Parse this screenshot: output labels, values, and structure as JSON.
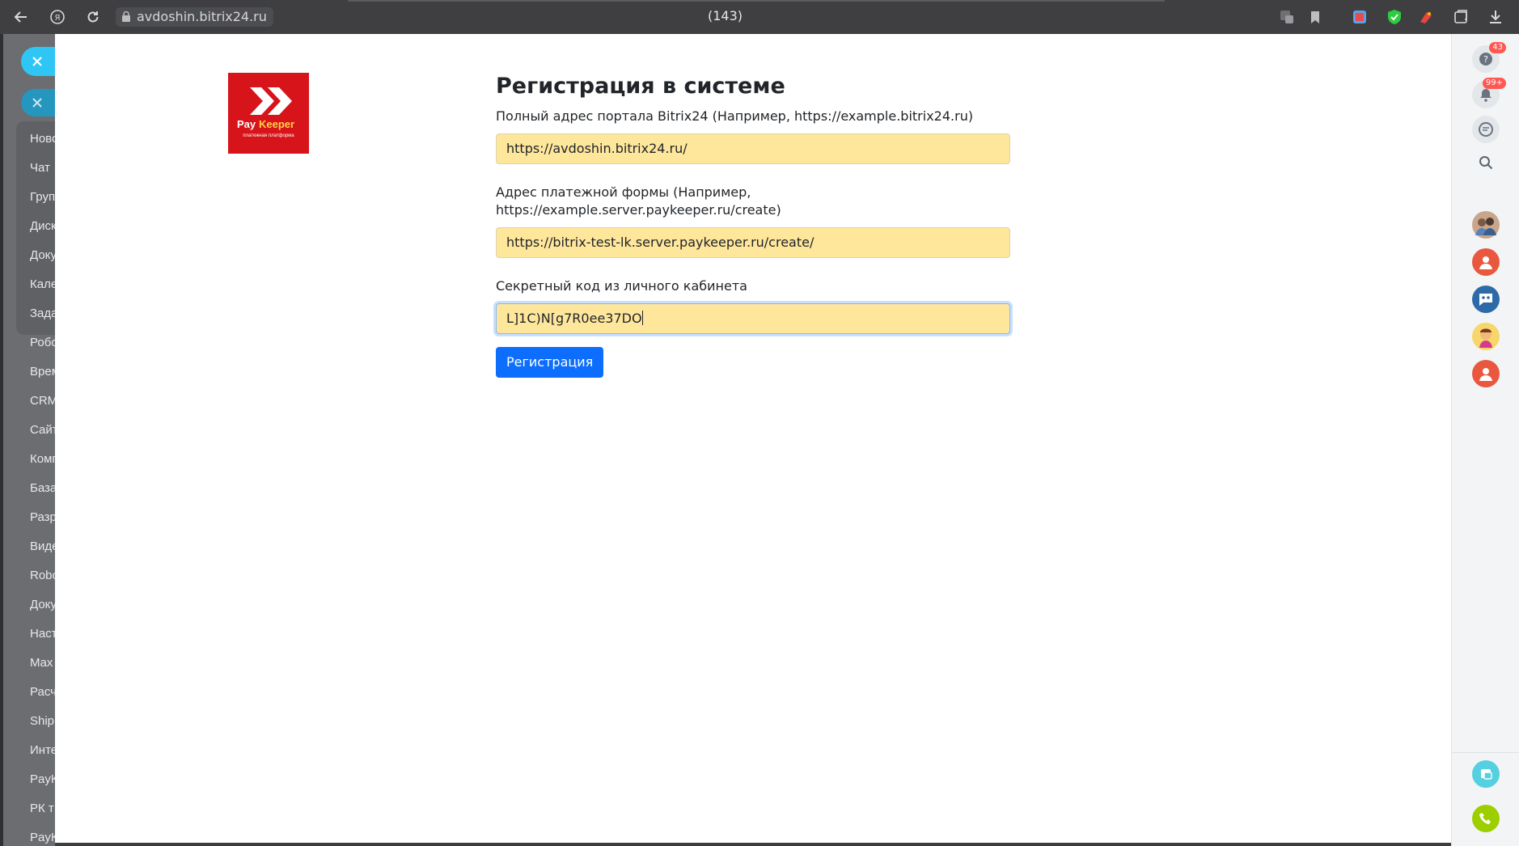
{
  "browser": {
    "url": "avdoshin.bitrix24.ru",
    "tab_title": "(143)",
    "icons": [
      "back-icon",
      "yandex-icon",
      "reload-icon",
      "lock-icon",
      "translate-icon",
      "bookmark-icon",
      "extension-icon",
      "protect-icon",
      "extension-icon",
      "collections-icon",
      "download-icon"
    ]
  },
  "left_menu": {
    "items": [
      "Ново",
      "Чат",
      "Груп",
      "Диск",
      "Доку",
      "Кале",
      "Зада",
      "Робо",
      "Врем",
      "CRM",
      "Сайт",
      "Комп",
      "База",
      "Разр",
      "Виде",
      "Robo",
      "Доку",
      "Наст",
      "Max",
      "Расч",
      "Ship",
      "Инте",
      "PayK",
      "РК т",
      "PayK"
    ]
  },
  "logo": {
    "brand_pay": "Pay",
    "brand_keeper": "Keeper",
    "tagline": "платежная платформа",
    "color": "#d7141a"
  },
  "form": {
    "title": "Регистрация в системе",
    "portal_label": "Полный адрес портала Bitrix24 (Например, https://example.bitrix24.ru)",
    "portal_value": "https://avdoshin.bitrix24.ru/",
    "payform_label": "Адрес платежной формы (Например, https://example.server.paykeeper.ru/create)",
    "payform_value": "https://bitrix-test-lk.server.paykeeper.ru/create/",
    "secret_label": "Секретный код из личного кабинета",
    "secret_value": "L]1C)N[g7R0ee37DO",
    "submit_label": "Регистрация"
  },
  "right_panel": {
    "help_badge": "43",
    "notifications_badge": "99+",
    "accent_color": "#2fc6f6"
  }
}
